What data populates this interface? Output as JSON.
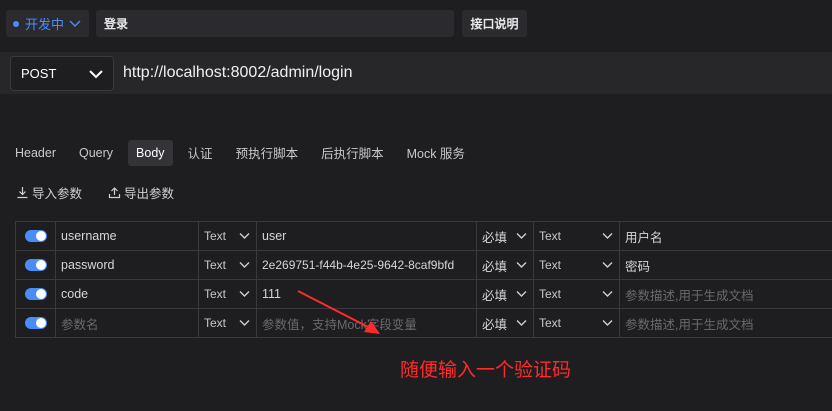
{
  "header": {
    "status_label": "开发中",
    "title": "登录",
    "doc_button": "接口说明"
  },
  "request": {
    "method": "POST",
    "url": "http://localhost:8002/admin/login"
  },
  "tabs": [
    {
      "label": "Header"
    },
    {
      "label": "Query"
    },
    {
      "label": "Body",
      "active": true
    },
    {
      "label": "认证"
    },
    {
      "label": "预执行脚本"
    },
    {
      "label": "后执行脚本"
    },
    {
      "label": "Mock 服务"
    }
  ],
  "tools": {
    "import_label": "导入参数",
    "export_label": "导出参数"
  },
  "params": [
    {
      "name": "username",
      "type": "Text",
      "value": "user",
      "required": "必填",
      "dtype": "Text",
      "desc": "用户名",
      "enabled": true
    },
    {
      "name": "password",
      "type": "Text",
      "value": "2e269751-f44b-4e25-9642-8caf9bfd",
      "required": "必填",
      "dtype": "Text",
      "desc": "密码",
      "enabled": true
    },
    {
      "name": "code",
      "type": "Text",
      "value": "111",
      "required": "必填",
      "dtype": "Text",
      "desc_placeholder": "参数描述,用于生成文档",
      "enabled": true
    },
    {
      "name_placeholder": "参数名",
      "type": "Text",
      "value_placeholder": "参数值，支持Mock字段变量",
      "required": "必填",
      "dtype": "Text",
      "desc_placeholder": "参数描述,用于生成文档",
      "enabled": true
    }
  ],
  "annotation": {
    "text": "随便输入一个验证码",
    "color": "#ff2a2a"
  },
  "colors": {
    "accent": "#4b8df8",
    "background": "#1e1e21"
  }
}
